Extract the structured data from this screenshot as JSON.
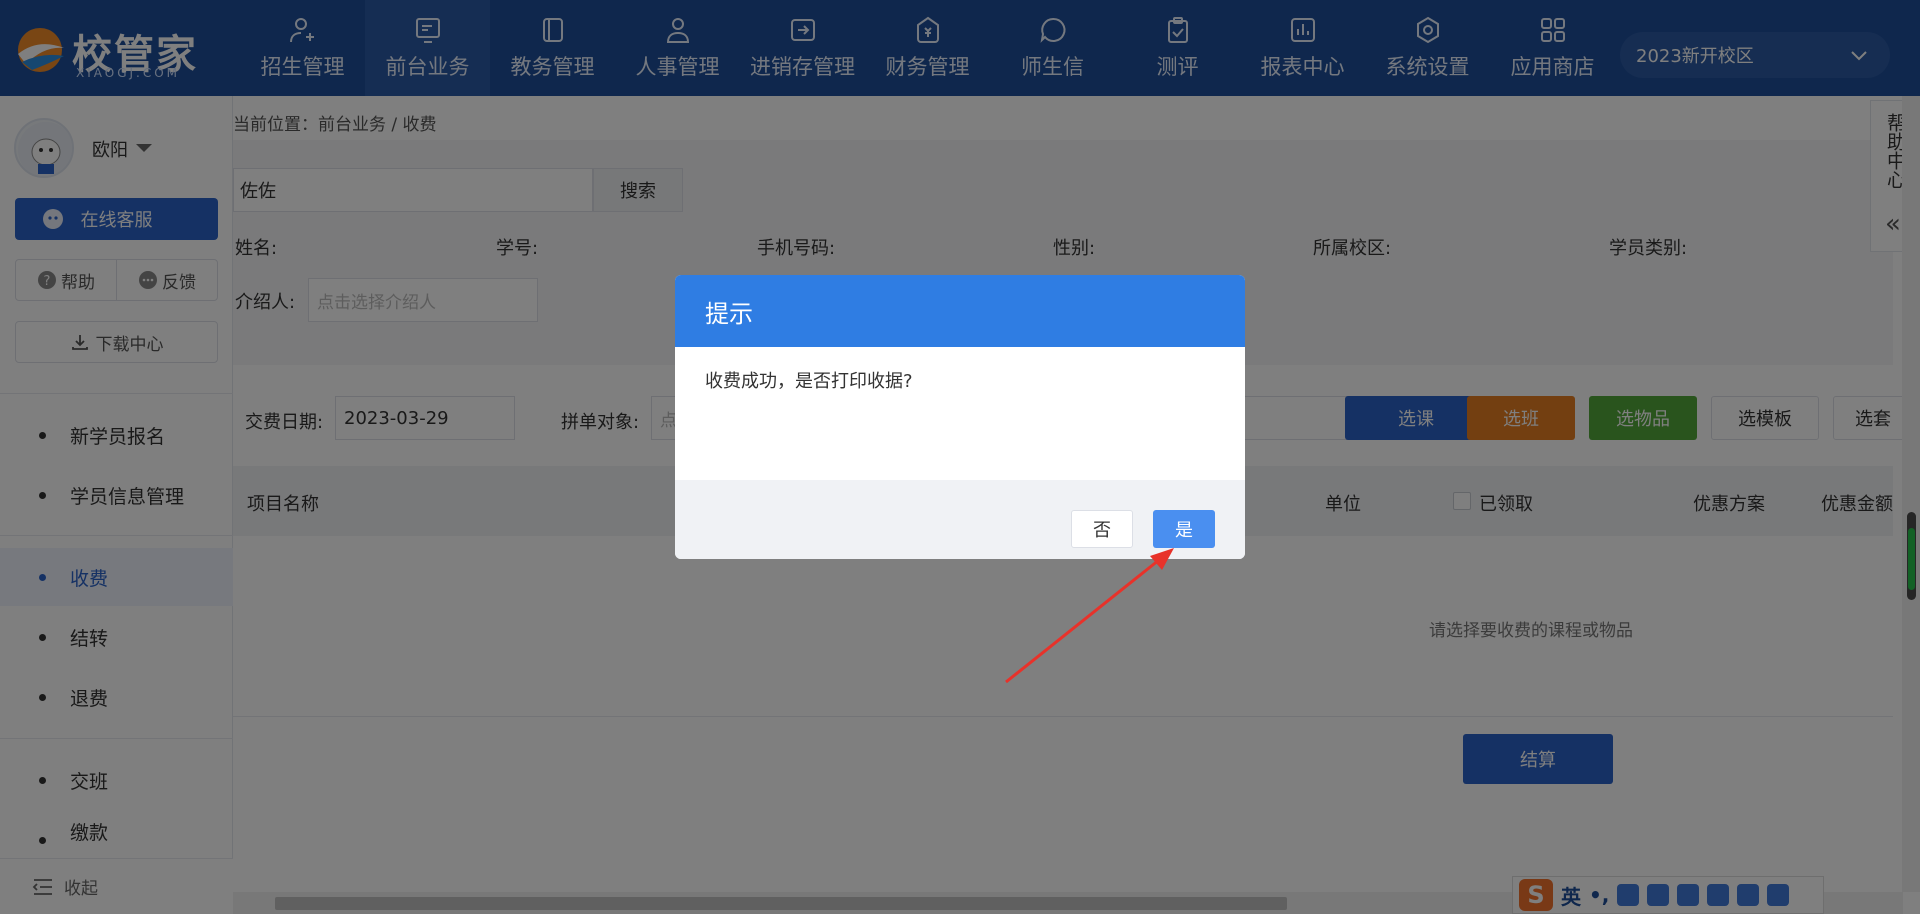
{
  "logo": {
    "name": "校管家",
    "sub": "XIAOGJ.COM"
  },
  "nav": [
    {
      "label": "招生管理",
      "icon": "add-user-icon"
    },
    {
      "label": "前台业务",
      "icon": "monitor-icon"
    },
    {
      "label": "教务管理",
      "icon": "book-icon"
    },
    {
      "label": "人事管理",
      "icon": "user-icon"
    },
    {
      "label": "进销存管理",
      "icon": "inventory-icon"
    },
    {
      "label": "财务管理",
      "icon": "money-bag-icon"
    },
    {
      "label": "师生信",
      "icon": "chat-icon"
    },
    {
      "label": "测评",
      "icon": "clipboard-icon"
    },
    {
      "label": "报表中心",
      "icon": "chart-icon"
    },
    {
      "label": "系统设置",
      "icon": "settings-icon"
    },
    {
      "label": "应用商店",
      "icon": "apps-icon"
    }
  ],
  "campus": {
    "value": "2023新开校区"
  },
  "sidebar": {
    "user": "欧阳",
    "service": "在线客服",
    "help": "帮助",
    "feedback": "反馈",
    "download": "下载中心",
    "menu1": [
      "新学员报名",
      "学员信息管理"
    ],
    "menu2": [
      "收费",
      "结转",
      "退费"
    ],
    "menu3": [
      "交班",
      "缴款"
    ],
    "collapse": "收起"
  },
  "main": {
    "breadcrumb": "当前位置：前台业务 / 收费",
    "search_value": "佐佐",
    "search_btn": "搜索",
    "fields": {
      "name": "姓名:",
      "student_no": "学号:",
      "phone": "手机号码:",
      "gender": "性别:",
      "campus": "所属校区:",
      "student_type": "学员类别:"
    },
    "referrer_label": "介绍人:",
    "referrer_placeholder": "点击选择介绍人",
    "pay_date_label": "交费日期:",
    "pay_date": "2023-03-29",
    "merge_label": "拼单对象:",
    "merge_placeholder": "点",
    "buttons": {
      "course": "选课",
      "class": "选班",
      "goods": "选物品",
      "template": "选模板",
      "more": "选套"
    },
    "table_headers": {
      "item": "项目名称",
      "unit": "单位",
      "received": "已领取",
      "discount": "优惠方案",
      "discount_amount": "优惠金额"
    },
    "empty_tip": "请选择要收费的课程或物品",
    "settle": "结算"
  },
  "help_center": "帮助中心",
  "ime": {
    "logo": "S",
    "lang": "英",
    "punct": "•,"
  },
  "dialog": {
    "title": "提示",
    "message": "收费成功，是否打印收据?",
    "no": "否",
    "yes": "是"
  },
  "colors": {
    "topbar": "#1f4f9a",
    "primary": "#2a62c9",
    "dialog_head": "#2f7de3",
    "orange": "#e67e22",
    "green": "#52a93b"
  }
}
